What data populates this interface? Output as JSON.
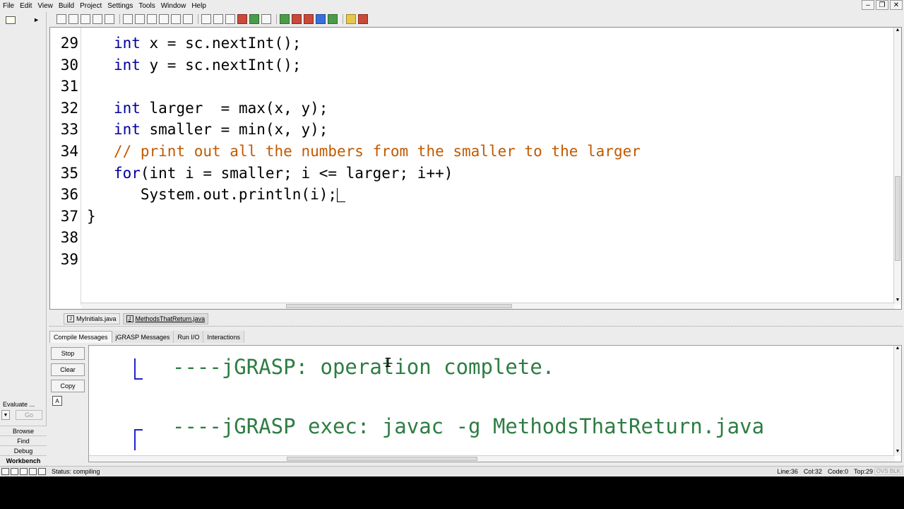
{
  "menu": [
    "File",
    "Edit",
    "View",
    "Build",
    "Project",
    "Settings",
    "Tools",
    "Window",
    "Help"
  ],
  "editor": {
    "lines": [
      {
        "num": "29",
        "indent": "   ",
        "kw": "int",
        "rest": " x = sc.nextInt();",
        "comment": ""
      },
      {
        "num": "30",
        "indent": "   ",
        "kw": "int",
        "rest": " y = sc.nextInt();",
        "comment": ""
      },
      {
        "num": "31",
        "indent": "",
        "kw": "",
        "rest": "",
        "comment": ""
      },
      {
        "num": "32",
        "indent": "   ",
        "kw": "int",
        "rest": " larger  = max(x, y);",
        "comment": ""
      },
      {
        "num": "33",
        "indent": "   ",
        "kw": "int",
        "rest": " smaller = min(x, y);",
        "comment": ""
      },
      {
        "num": "34",
        "indent": "   ",
        "kw": "",
        "rest": "",
        "comment": "// print out all the numbers from the smaller to the larger"
      },
      {
        "num": "35",
        "indent": "   ",
        "kw": "for",
        "rest": "(int i = smaller; i <= larger; i++)",
        "comment": ""
      },
      {
        "num": "36",
        "indent": "      ",
        "kw": "",
        "rest": "System.out.println(i);",
        "comment": ""
      },
      {
        "num": "37",
        "indent": "",
        "kw": "",
        "rest": "}",
        "comment": ""
      },
      {
        "num": "38",
        "indent": "",
        "kw": "",
        "rest": "",
        "comment": ""
      },
      {
        "num": "39",
        "indent": "",
        "kw": "",
        "rest": "",
        "comment": ""
      }
    ]
  },
  "file_tabs": [
    {
      "label": "MyInitials.java",
      "active": false
    },
    {
      "label": "MethodsThatReturn.java",
      "active": true
    }
  ],
  "message_tabs": [
    {
      "label": "Compile Messages",
      "active": true
    },
    {
      "label": "jGRASP Messages",
      "active": false
    },
    {
      "label": "Run I/O",
      "active": false
    },
    {
      "label": "Interactions",
      "active": false
    }
  ],
  "message_buttons": {
    "stop": "Stop",
    "clear": "Clear",
    "copy": "Copy",
    "icon_label": "A"
  },
  "messages": [
    "----jGRASP: operation complete.",
    "----jGRASP exec: javac -g MethodsThatReturn.java"
  ],
  "left_panel": {
    "evaluate_label": "Evaluate ...",
    "go_label": "Go",
    "tabs": [
      "Browse",
      "Find",
      "Debug",
      "Workbench"
    ]
  },
  "statusbar": {
    "status": "Status: compiling",
    "line": "Line:36",
    "col": "Col:32",
    "code": "Code:0",
    "top": "Top:29",
    "mode": "OVS BLK"
  }
}
